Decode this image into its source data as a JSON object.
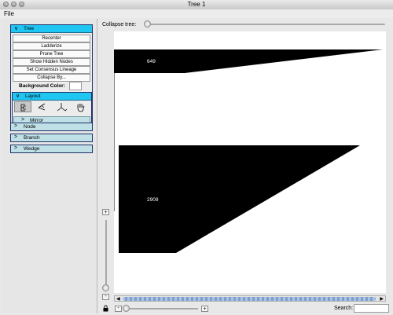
{
  "window": {
    "title": "Tree 1"
  },
  "menu": {
    "file_label": "File"
  },
  "left_panel": {
    "tree_section": {
      "header_label": "Tree",
      "buttons": [
        "Recenter",
        "Ladderize",
        "Prune Tree",
        "Show Hidden Nodes",
        "Set Consensus Lineage",
        "Collapse By..."
      ],
      "background_color_label": "Background Color:",
      "background_color_value": "#ffffff",
      "layout": {
        "header_label": "Layout",
        "icons": [
          "rectangular-layout-icon",
          "slanted-layout-icon",
          "radial-layout-icon",
          "hand-pan-icon"
        ],
        "mirror_label": "Mirror"
      }
    },
    "sections": [
      {
        "label": "Node"
      },
      {
        "label": "Branch"
      },
      {
        "label": "Wedge"
      }
    ]
  },
  "collapse_tree": {
    "label": "Collapse tree:",
    "value": 0
  },
  "tree_canvas": {
    "wedges": [
      {
        "label": "649"
      },
      {
        "label": "2909"
      }
    ]
  },
  "zoom": {
    "plus": "+",
    "minus": "-"
  },
  "search": {
    "label": "Search:",
    "value": ""
  },
  "colors": {
    "accent": "#1fc6f2",
    "section_bg": "#bfe0e6",
    "wedge": "#000000"
  }
}
